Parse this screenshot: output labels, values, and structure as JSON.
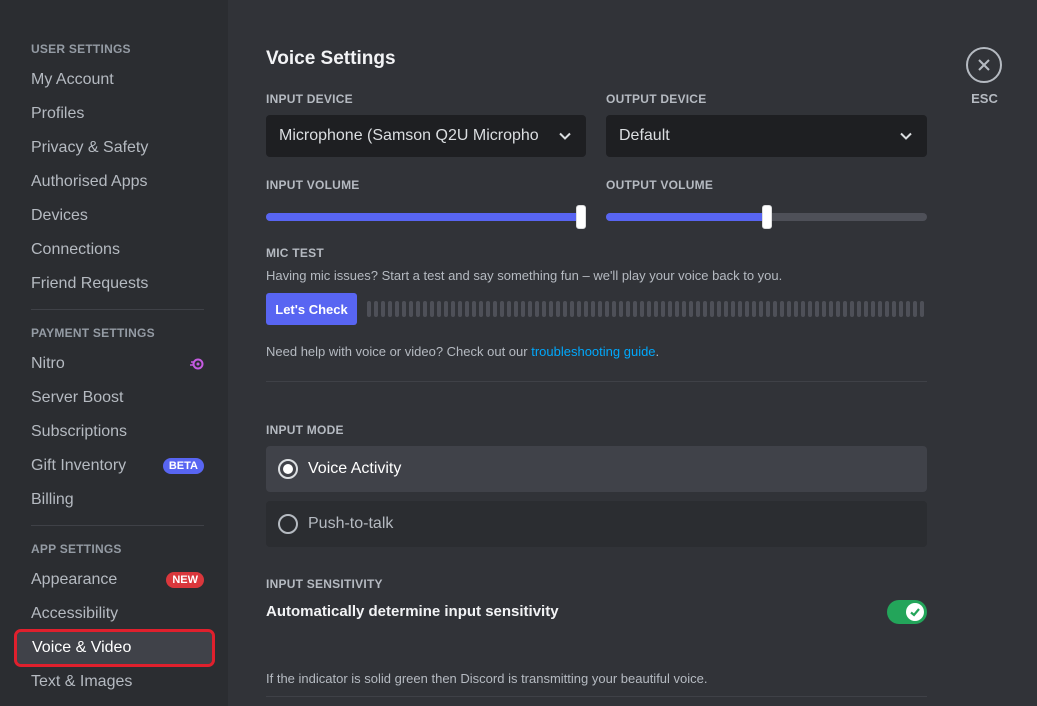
{
  "sidebar": {
    "user_settings": {
      "header": "USER SETTINGS",
      "items": [
        "My Account",
        "Profiles",
        "Privacy & Safety",
        "Authorised Apps",
        "Devices",
        "Connections",
        "Friend Requests"
      ]
    },
    "payment_settings": {
      "header": "PAYMENT SETTINGS",
      "items": [
        "Nitro",
        "Server Boost",
        "Subscriptions",
        "Gift Inventory",
        "Billing"
      ],
      "gift_badge": "BETA",
      "nitro_icon": "nitro-icon"
    },
    "app_settings": {
      "header": "APP SETTINGS",
      "items": [
        "Appearance",
        "Accessibility",
        "Voice & Video",
        "Text & Images"
      ],
      "appearance_badge": "NEW",
      "selected": "Voice & Video"
    }
  },
  "main": {
    "title": "Voice Settings",
    "input_device": {
      "label": "INPUT DEVICE",
      "value": "Microphone (Samson Q2U Micropho"
    },
    "output_device": {
      "label": "OUTPUT DEVICE",
      "value": "Default"
    },
    "input_volume": {
      "label": "INPUT VOLUME",
      "level": 1.0
    },
    "output_volume": {
      "label": "OUTPUT VOLUME",
      "level": 0.5
    },
    "mic_test": {
      "label": "MIC TEST",
      "description": "Having mic issues? Start a test and say something fun – we'll play your voice back to you.",
      "button": "Let's Check"
    },
    "help": {
      "prefix": "Need help with voice or video? Check out our ",
      "link": "troubleshooting guide",
      "suffix": "."
    },
    "input_mode": {
      "label": "INPUT MODE",
      "options": [
        "Voice Activity",
        "Push-to-talk"
      ],
      "selected": "Voice Activity"
    },
    "input_sensitivity": {
      "label": "INPUT SENSITIVITY",
      "toggle_label": "Automatically determine input sensitivity",
      "enabled": true,
      "note": "If the indicator is solid green then Discord is transmitting your beautiful voice."
    }
  },
  "close": {
    "label": "ESC"
  },
  "colors": {
    "accent": "#5865f2",
    "link": "#00a8fc",
    "toggle_on": "#23a55a",
    "highlight": "#e0202d"
  }
}
